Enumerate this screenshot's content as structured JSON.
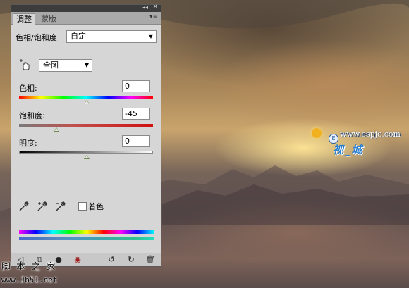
{
  "panel": {
    "tabs": [
      {
        "label": "调整",
        "active": true
      },
      {
        "label": "蒙版",
        "active": false
      }
    ],
    "adjustment_title": "色相/饱和度",
    "preset_value": "自定",
    "channel_value": "全图",
    "sliders": [
      {
        "label": "色相:",
        "value": "0",
        "level": 0.5
      },
      {
        "label": "饱和度:",
        "value": "-45",
        "level": 0.275
      },
      {
        "label": "明度:",
        "value": "0",
        "level": 0.5
      }
    ],
    "colorize_label": "着色",
    "colorize_checked": false
  },
  "watermark": {
    "url": "www.espjc.com",
    "logo_text": "视_城",
    "site_text": "脚 本 之 家",
    "site_url": "www.Jb51.net"
  },
  "icons": {
    "hand_tool": "target-adjust-icon",
    "eyedroppers": [
      "eyedropper-icon",
      "eyedropper-plus-icon",
      "eyedropper-minus-icon"
    ],
    "bottom": [
      "back-arrow-icon",
      "expand-view-icon",
      "clip-layer-icon",
      "visibility-icon",
      "view-previous-icon",
      "reset-icon",
      "trash-icon"
    ]
  }
}
